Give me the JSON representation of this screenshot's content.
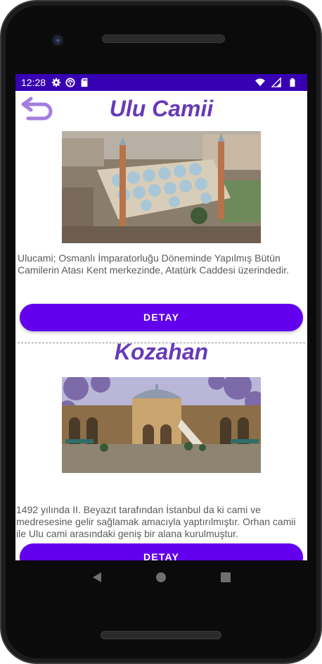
{
  "status_bar": {
    "time": "12:28",
    "icons_left": [
      "gear-icon",
      "vpn-icon",
      "sd-card-icon"
    ],
    "icons_right": [
      "wifi-icon",
      "signal-icon",
      "battery-icon"
    ],
    "background": "#3700b3"
  },
  "back_button": {
    "icon": "back-arrow-icon",
    "color": "#673ab7"
  },
  "places": [
    {
      "title": "Ulu Camii",
      "image": "mosque-photo",
      "description": "Ulucami; Osmanlı İmparatorluğu Döneminde Yapılmış Bütün Camilerin Atası Kent merkezinde, Atatürk Caddesi üzerindedir.",
      "button_label": "DETAY"
    },
    {
      "title": "Kozahan",
      "image": "caravanserai-photo",
      "description": "1492 yılında II. Beyazıt tarafından İstanbul da ki cami ve medresesine gelir sağlamak amacıyla yaptırılmıştır. Orhan camii ile Ulu cami arasındaki geniş bir alana kurulmuştur.",
      "button_label": "DETAY"
    }
  ],
  "nav_bar": {
    "buttons": [
      "back-triangle-icon",
      "home-circle-icon",
      "recents-square-icon"
    ]
  },
  "colors": {
    "title": "#673ab7",
    "button": "#6200ee",
    "text": "#5a5a5a"
  }
}
